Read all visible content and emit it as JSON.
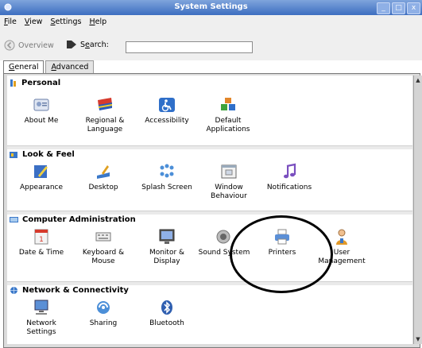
{
  "window": {
    "title": "System Settings",
    "min": "_",
    "max": "□",
    "close": "x"
  },
  "menu": [
    {
      "key": "F",
      "rest": "ile"
    },
    {
      "key": "V",
      "rest": "iew"
    },
    {
      "key": "S",
      "rest": "ettings"
    },
    {
      "key": "H",
      "rest": "elp"
    }
  ],
  "toolbar": {
    "overview": "Overview",
    "search_prefix": "S",
    "search_key": "e",
    "search_rest": "arch:",
    "search_value": ""
  },
  "tabs": [
    {
      "key": "G",
      "rest": "eneral",
      "active": true
    },
    {
      "key": "A",
      "rest": "dvanced",
      "active": false
    }
  ],
  "sections": {
    "personal": {
      "title": "Personal",
      "items": [
        "About Me",
        "Regional & Language",
        "Accessibility",
        "Default Applications"
      ]
    },
    "look": {
      "title": "Look & Feel",
      "items": [
        "Appearance",
        "Desktop",
        "Splash Screen",
        "Window Behaviour",
        "Notifications"
      ]
    },
    "admin": {
      "title": "Computer Administration",
      "items": [
        "Date & Time",
        "Keyboard & Mouse",
        "Monitor & Display",
        "Sound System",
        "Printers",
        "User Management"
      ]
    },
    "network": {
      "title": "Network & Connectivity",
      "items": [
        "Network Settings",
        "Sharing",
        "Bluetooth"
      ]
    }
  },
  "scroll": {
    "up": "▲",
    "down": "▼"
  }
}
